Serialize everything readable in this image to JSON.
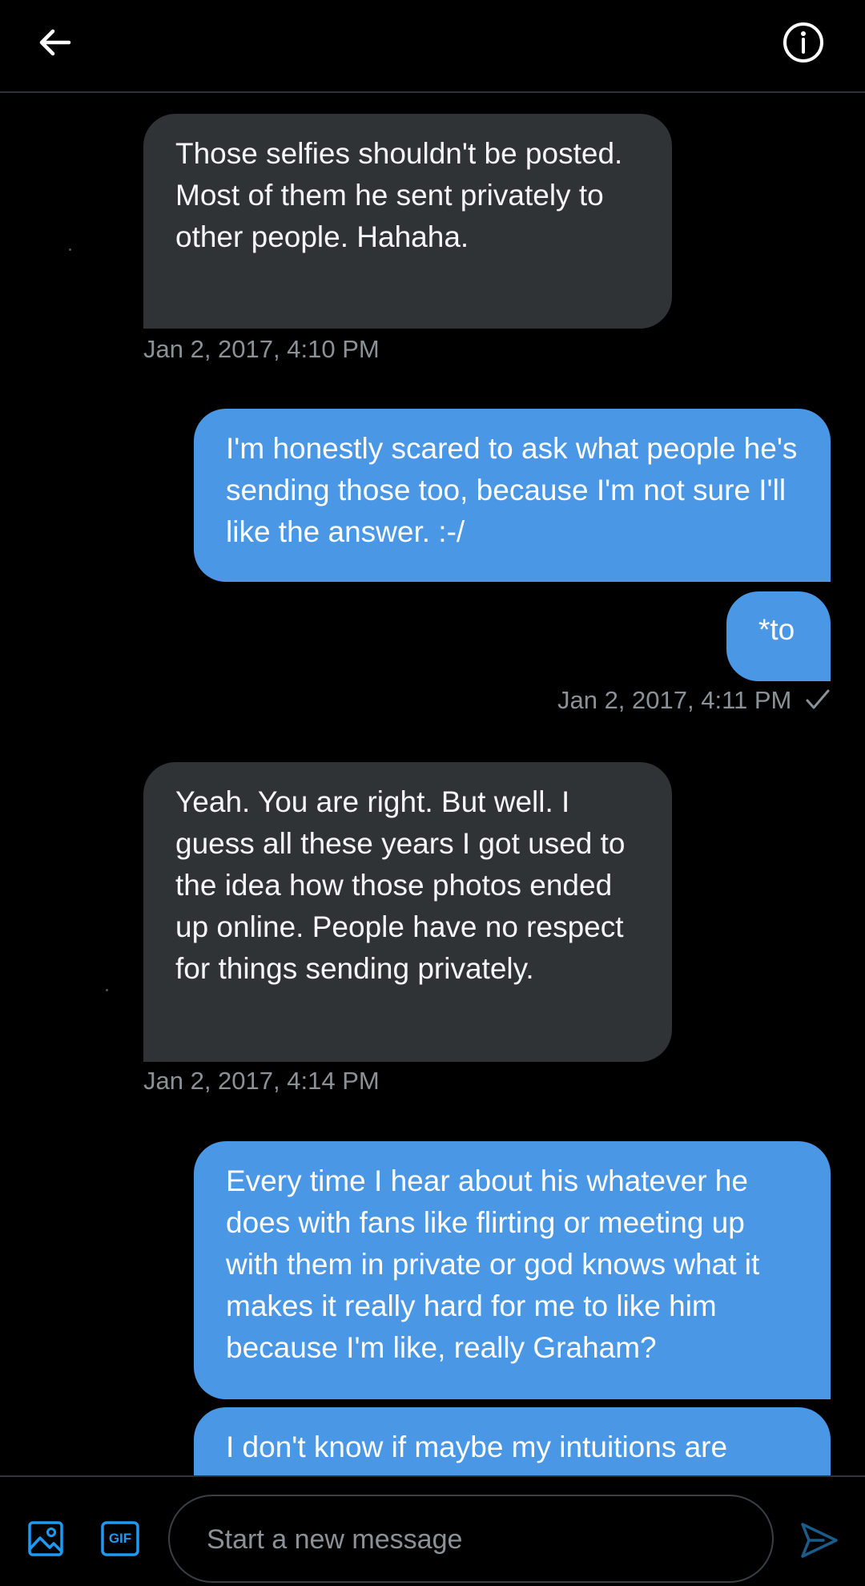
{
  "header": {
    "back_icon": "arrow-left-icon",
    "info_icon": "info-circle-icon"
  },
  "messages": [
    {
      "direction": "received",
      "text": "Those selfies shouldn't be posted. Most of them he sent privately to other people. Hahaha."
    },
    {
      "direction": "received",
      "timestamp": "Jan 2, 2017, 4:10 PM"
    },
    {
      "direction": "sent",
      "text": "I'm honestly scared to ask what people he's sending those too, because I'm not sure I'll like the answer. :-/"
    },
    {
      "direction": "sent",
      "text": "*to"
    },
    {
      "direction": "sent",
      "timestamp": "Jan 2, 2017, 4:11 PM",
      "status_icon": "checkmark-icon"
    },
    {
      "direction": "received",
      "text": "Yeah. You are right. But well. I guess all these years I got used to the idea how those photos ended up online. People have no respect for things sending privately."
    },
    {
      "direction": "received",
      "timestamp": "Jan 2, 2017, 4:14 PM"
    },
    {
      "direction": "sent",
      "text": "Every time I hear about his whatever he does with fans like flirting or meeting up with them in private or god knows what it makes it really hard for me to like him because I'm like, really Graham?"
    },
    {
      "direction": "sent",
      "text": "I don't know if maybe my intuitions are"
    }
  ],
  "composer": {
    "placeholder": "Start a new message",
    "media_icon": "image-icon",
    "gif_label": "GIF",
    "send_icon": "send-icon"
  },
  "colors": {
    "background": "#000000",
    "received_bubble": "#2f3336",
    "sent_bubble": "#4a97e6",
    "accent": "#1d9bf0"
  }
}
